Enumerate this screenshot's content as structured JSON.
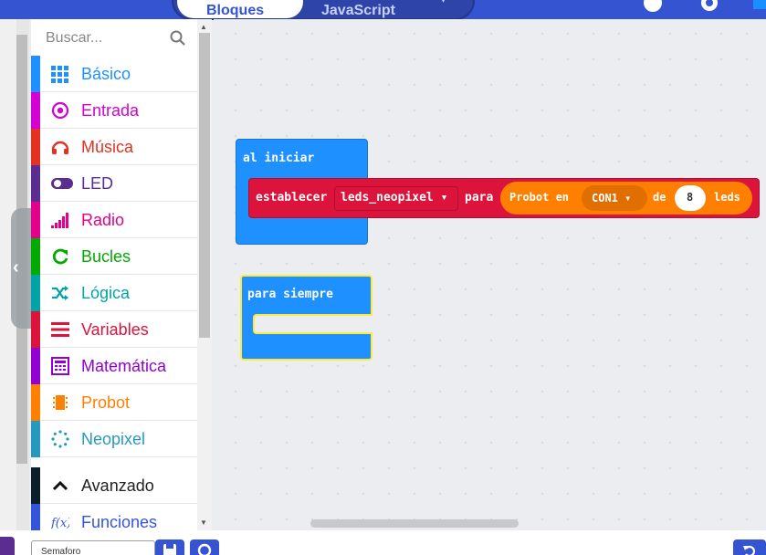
{
  "top": {
    "tab_blocks": "Bloques",
    "tab_js": "JavaScript"
  },
  "toolbox": {
    "search_placeholder": "Buscar...",
    "categories": [
      {
        "label": "Básico",
        "color": "#1e90ff",
        "icon": "grid-icon"
      },
      {
        "label": "Entrada",
        "color": "#d400d4",
        "icon": "target-icon"
      },
      {
        "label": "Música",
        "color": "#e63022",
        "icon": "headphones-icon"
      },
      {
        "label": "LED",
        "color": "#5c2d91",
        "icon": "toggle-icon"
      },
      {
        "label": "Radio",
        "color": "#e3008c",
        "icon": "signal-bars-icon"
      },
      {
        "label": "Bucles",
        "color": "#00aa00",
        "icon": "refresh-icon"
      },
      {
        "label": "Lógica",
        "color": "#00a4a6",
        "icon": "shuffle-icon"
      },
      {
        "label": "Variables",
        "color": "#dc143c",
        "icon": "list-lines-icon"
      },
      {
        "label": "Matemática",
        "color": "#9400d3",
        "icon": "calculator-icon"
      },
      {
        "label": "Probot",
        "color": "#ff8000",
        "icon": "chip-icon"
      },
      {
        "label": "Neopixel",
        "color": "#2699bf",
        "icon": "dotted-ring-icon"
      },
      {
        "label": "Avanzado",
        "color": "#0b1f2a",
        "icon": "chevron-up-icon"
      },
      {
        "label": "Funciones",
        "color": "#3455db",
        "icon": "function-icon"
      }
    ]
  },
  "workspace": {
    "on_start": "al iniciar",
    "set_label": "establecer",
    "var_name": "leds_neopixel",
    "to_label": "para",
    "probot_label": "Probot en",
    "port": "CON1",
    "of_label": "de",
    "count": "8",
    "leds_label": "leds",
    "forever": "para siempre"
  },
  "bottom": {
    "project_name": "Semaforo"
  }
}
